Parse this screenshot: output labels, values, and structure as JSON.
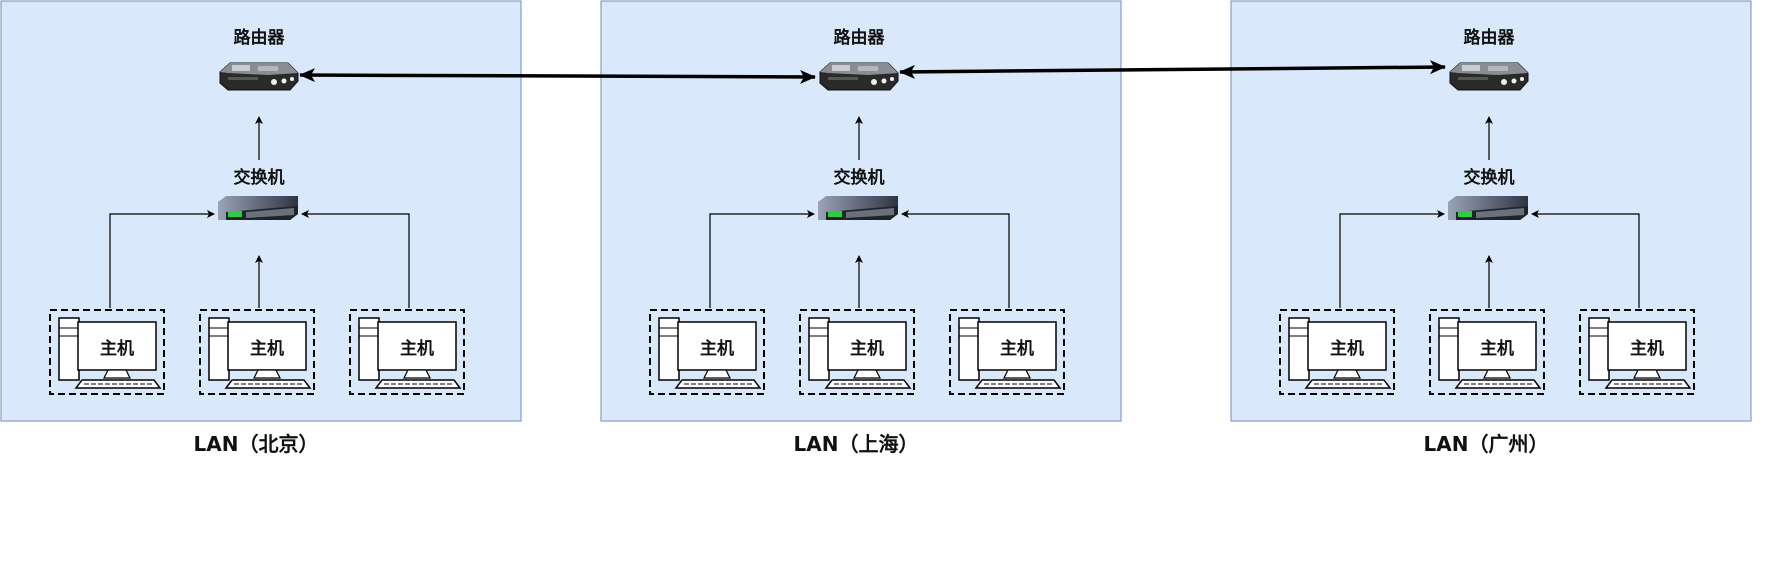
{
  "lans": [
    {
      "title": "LAN（北京）",
      "router_label": "路由器",
      "switch_label": "交换机",
      "hosts": [
        {
          "label": "主机"
        },
        {
          "label": "主机"
        },
        {
          "label": "主机"
        }
      ]
    },
    {
      "title": "LAN（上海）",
      "router_label": "路由器",
      "switch_label": "交换机",
      "hosts": [
        {
          "label": "主机"
        },
        {
          "label": "主机"
        },
        {
          "label": "主机"
        }
      ]
    },
    {
      "title": "LAN（广州）",
      "router_label": "路由器",
      "switch_label": "交换机",
      "hosts": [
        {
          "label": "主机"
        },
        {
          "label": "主机"
        },
        {
          "label": "主机"
        }
      ]
    }
  ],
  "connections": [
    {
      "from": "LAN（北京）",
      "to": "LAN（上海）",
      "type": "bidirectional"
    },
    {
      "from": "LAN（上海）",
      "to": "LAN（广州）",
      "type": "bidirectional"
    }
  ],
  "colors": {
    "lan_fill": "#dae8fc",
    "lan_border": "#6c8ebf",
    "line": "#000000"
  }
}
